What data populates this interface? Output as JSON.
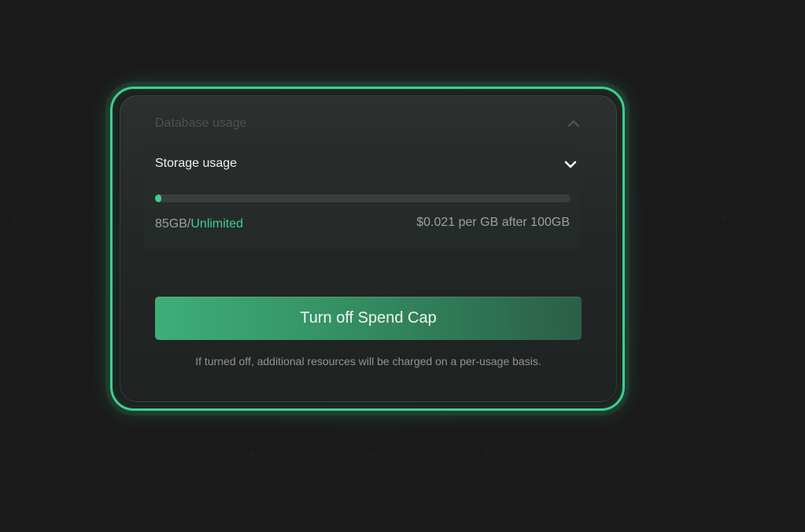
{
  "database_row": {
    "label": "Database usage",
    "chevron_icon": "chevron-up-icon"
  },
  "storage_row": {
    "label": "Storage usage",
    "chevron_icon": "chevron-down-icon",
    "progress_fraction": 0.015,
    "usage_amount": "85GB/",
    "usage_limit": "Unlimited",
    "price_note": "$0.021 per GB after 100GB"
  },
  "cta": {
    "label": "Turn off Spend Cap"
  },
  "footnote": "If turned off, additional resources will be charged on a per-usage basis.",
  "colors": {
    "accent": "#3ecf8e",
    "background": "#1a1a1a",
    "card": "#232826"
  }
}
